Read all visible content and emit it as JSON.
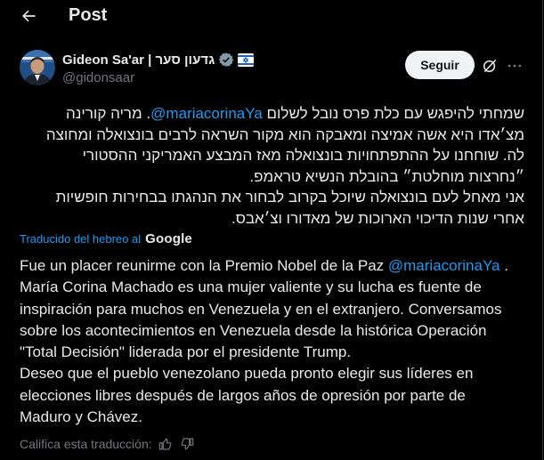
{
  "header": {
    "title": "Post"
  },
  "author": {
    "name": "Gideon Sa'ar | גדעון סער",
    "handle": "@gidonsaar",
    "follow_label": "Seguir"
  },
  "post": {
    "hebrew_lines": [
      {
        "pre": "שמחתי להיפגש עם כלת פרס נובל לשלום ",
        "mention": "@mariacorinaYa",
        "post": ". מריה קורינה"
      },
      {
        "text": "מצ׳אדו היא אשה אמיצה ומאבקה הוא מקור השראה לרבים בונצואלה ומחוצה"
      },
      {
        "text": "לה. שוחחנו על ההתפתחויות בונצואלה מאז המבצע האמריקני ההסטורי"
      },
      {
        "text": "״נחרצות מוחלטת״ בהובלת הנשיא טראמפ."
      },
      {
        "text": "אני מאחל לעם בונצואלה שיוכל בקרוב לבחור את הנהגתו בבחירות חופשיות"
      },
      {
        "text": "אחרי שנות הדיכוי הארוכות של מאדורו וצ׳אבס."
      }
    ],
    "translated_label": "Traducido del hebreo al",
    "translator_brand": "Google",
    "spanish_lines": [
      {
        "pre": "Fue un placer reunirme con la Premio Nobel de la Paz ",
        "mention": "@mariacorinaYa",
        "post": " ."
      },
      {
        "text": "María Corina Machado es una mujer valiente y su lucha es fuente de"
      },
      {
        "text": "inspiración para muchos en Venezuela y en el extranjero. Conversamos"
      },
      {
        "text": "sobre los acontecimientos en Venezuela desde la histórica Operación"
      },
      {
        "text": "\"Total Decisión\" liderada por el presidente Trump."
      },
      {
        "text": "Deseo que el pueblo venezolano pueda pronto elegir sus líderes en"
      },
      {
        "text": "elecciones libres después de largos años de opresión por parte de"
      },
      {
        "text": "Maduro y Chávez."
      }
    ],
    "rate_label": "Califica esta traducción:"
  },
  "icons": {
    "back": "arrow-left-icon",
    "verified": "verified-badge-icon",
    "flag": "israel-flag-icon",
    "grok": "grok-icon",
    "more": "more-icon",
    "thumbs_up": "thumbs-up-icon",
    "thumbs_down": "thumbs-down-icon"
  },
  "colors": {
    "background": "#000000",
    "text": "#e7e9ea",
    "muted": "#71767b",
    "link": "#1d9bf0",
    "follow_bg": "#eff3f4"
  }
}
